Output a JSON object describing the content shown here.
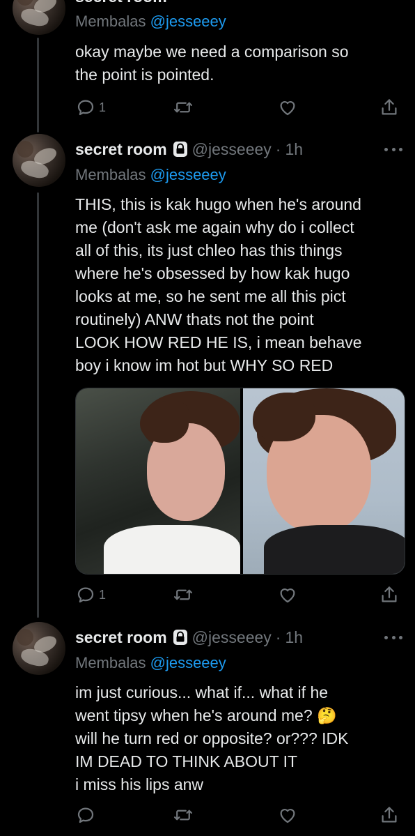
{
  "colors": {
    "background": "#000000",
    "text": "#e7e9ea",
    "muted": "#71767b",
    "accent": "#1d9bf0"
  },
  "tweets": [
    {
      "header_partial": "secret room",
      "reply_prefix": "Membalas",
      "reply_to": "@jesseeey",
      "text": [
        "okay maybe we need a comparison so",
        "the point is pointed."
      ],
      "reply_count": "1"
    },
    {
      "author_name": "secret room",
      "lock_icon": "lock-icon",
      "handle": "@jesseeey",
      "dot": "·",
      "time": "1h",
      "reply_prefix": "Membalas",
      "reply_to": "@jesseeey",
      "text": [
        "THIS, this is kak hugo when he's around",
        "me (don't ask me again why do i collect",
        "all of this, its just chleo has this things",
        "where he's obsessed by how kak hugo",
        "looks at me, so he sent me all this pict",
        "routinely) ANW thats not the point",
        "LOOK HOW RED HE IS, i mean behave",
        "boy i know im hot but WHY SO RED"
      ],
      "media_count": 2,
      "reply_count": "1"
    },
    {
      "author_name": "secret room",
      "lock_icon": "lock-icon",
      "handle": "@jesseeey",
      "dot": "·",
      "time": "1h",
      "reply_prefix": "Membalas",
      "reply_to": "@jesseeey",
      "text": [
        "im just curious... what if... what if he",
        "went tipsy when he's around me? 🤔",
        "will he turn red or opposite? or??? IDK",
        "IM DEAD TO THINK ABOUT IT",
        "i miss his lips anw"
      ],
      "reply_count": ""
    }
  ],
  "icons": [
    "reply-icon",
    "retweet-icon",
    "like-icon",
    "share-icon",
    "more-icon",
    "lock-icon"
  ]
}
